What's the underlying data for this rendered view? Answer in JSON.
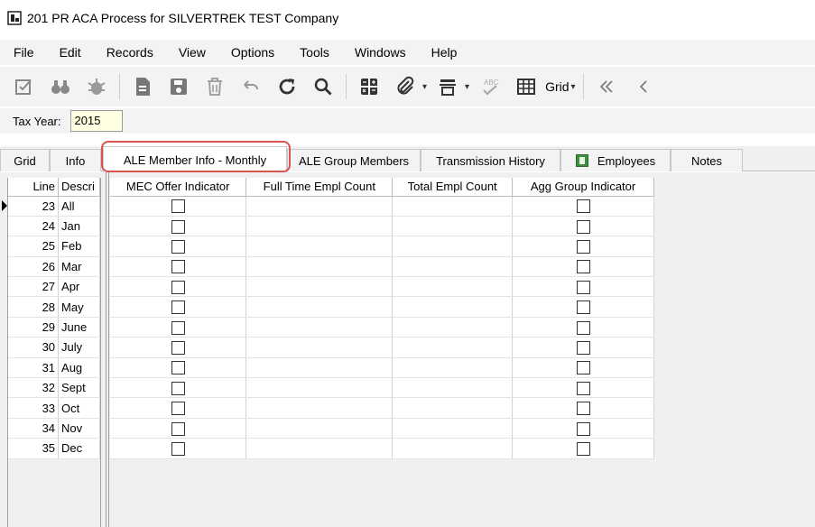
{
  "window": {
    "title": "201 PR ACA Process for SILVERTREK TEST Company",
    "icon": "app-window-icon"
  },
  "menu": [
    "File",
    "Edit",
    "Records",
    "View",
    "Options",
    "Tools",
    "Windows",
    "Help"
  ],
  "toolbar": {
    "icons": [
      "edit-check-icon",
      "binoculars-icon",
      "bug-icon",
      "new-document-icon",
      "save-icon",
      "delete-icon",
      "undo-icon",
      "refresh-icon",
      "search-icon",
      "calculator-icon",
      "attachment-icon",
      "print-icon",
      "spellcheck-icon",
      "grid-icon",
      "first-record-icon",
      "previous-record-icon"
    ],
    "grid_label": "Grid"
  },
  "tax_year": {
    "label": "Tax Year:",
    "value": "2015"
  },
  "tabs": [
    "Grid",
    "Info",
    "ALE Member Info - Monthly",
    "ALE Group Members",
    "Transmission History",
    "Employees",
    "Notes"
  ],
  "active_tab": "ALE Member Info - Monthly",
  "left_grid": {
    "columns": [
      "Line",
      "Descri"
    ],
    "rows": [
      {
        "line": "23",
        "desc": "All"
      },
      {
        "line": "24",
        "desc": "Jan"
      },
      {
        "line": "25",
        "desc": "Feb"
      },
      {
        "line": "26",
        "desc": "Mar"
      },
      {
        "line": "27",
        "desc": "Apr"
      },
      {
        "line": "28",
        "desc": "May"
      },
      {
        "line": "29",
        "desc": "June"
      },
      {
        "line": "30",
        "desc": "July"
      },
      {
        "line": "31",
        "desc": "Aug"
      },
      {
        "line": "32",
        "desc": "Sept"
      },
      {
        "line": "33",
        "desc": "Oct"
      },
      {
        "line": "34",
        "desc": "Nov"
      },
      {
        "line": "35",
        "desc": "Dec"
      }
    ]
  },
  "right_grid": {
    "columns": [
      "MEC Offer Indicator",
      "Full Time Empl Count",
      "Total Empl Count",
      "Agg Group Indicator"
    ],
    "rows": [
      {
        "mec": false,
        "ft": "",
        "total": "",
        "agg": false
      },
      {
        "mec": false,
        "ft": "",
        "total": "",
        "agg": false
      },
      {
        "mec": false,
        "ft": "",
        "total": "",
        "agg": false
      },
      {
        "mec": false,
        "ft": "",
        "total": "",
        "agg": false
      },
      {
        "mec": false,
        "ft": "",
        "total": "",
        "agg": false
      },
      {
        "mec": false,
        "ft": "",
        "total": "",
        "agg": false
      },
      {
        "mec": false,
        "ft": "",
        "total": "",
        "agg": false
      },
      {
        "mec": false,
        "ft": "",
        "total": "",
        "agg": false
      },
      {
        "mec": false,
        "ft": "",
        "total": "",
        "agg": false
      },
      {
        "mec": false,
        "ft": "",
        "total": "",
        "agg": false
      },
      {
        "mec": false,
        "ft": "",
        "total": "",
        "agg": false
      },
      {
        "mec": false,
        "ft": "",
        "total": "",
        "agg": false
      },
      {
        "mec": false,
        "ft": "",
        "total": "",
        "agg": false
      }
    ]
  },
  "colors": {
    "tab_highlight": "#d9534f",
    "tax_year_bg": "#ffffe1"
  }
}
